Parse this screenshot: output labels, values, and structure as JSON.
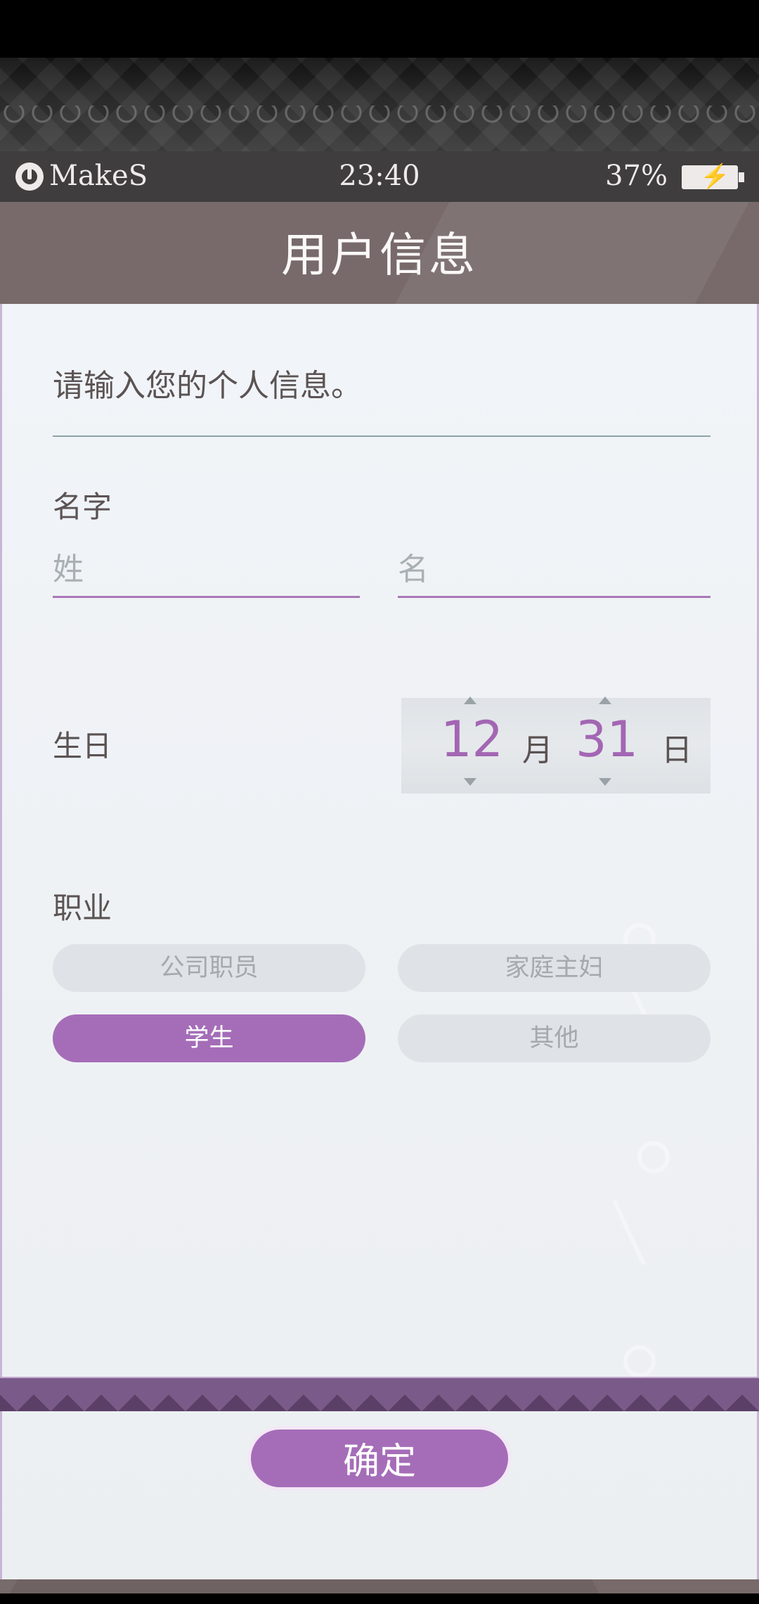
{
  "status_bar": {
    "app_name": "MakeS",
    "time": "23:40",
    "battery": "37%"
  },
  "header": {
    "title": "用户信息"
  },
  "form": {
    "intro": "请输入您的个人信息。",
    "name_label": "名字",
    "surname_placeholder": "姓",
    "given_name_placeholder": "名",
    "birthday_label": "生日",
    "birthday": {
      "month": "12",
      "month_unit": "月",
      "day": "31",
      "day_unit": "日"
    },
    "occupation_label": "职业",
    "occupations": [
      {
        "label": "公司职员",
        "selected": false
      },
      {
        "label": "家庭主妇",
        "selected": false
      },
      {
        "label": "学生",
        "selected": true
      },
      {
        "label": "其他",
        "selected": false
      }
    ]
  },
  "confirm_label": "确定",
  "colors": {
    "accent": "#a56db8",
    "header_bg": "#786a6a",
    "panel_bg": "#f1f4f8"
  }
}
